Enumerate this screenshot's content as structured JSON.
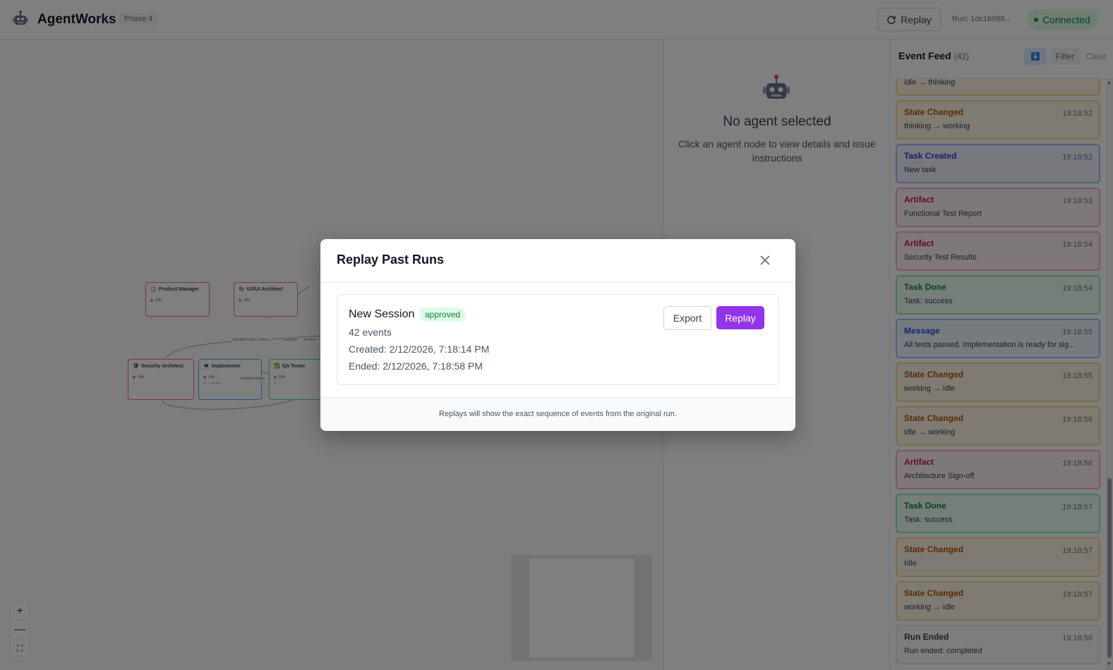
{
  "header": {
    "app_title": "AgentWorks",
    "phase": "Phase 4",
    "replay_label": "Replay",
    "run_id": "Run: 1dc16998...",
    "connection_status": "Connected"
  },
  "canvas": {
    "nodes": [
      {
        "title": "Product Manager",
        "status": "idle",
        "extra": ""
      },
      {
        "title": "UX/UI Architect",
        "status": "idle",
        "extra": ""
      },
      {
        "title": "Security Architect",
        "status": "idle",
        "extra": "2"
      },
      {
        "title": "Implementer",
        "status": "idle",
        "extra": "3 · ⚡ Active"
      },
      {
        "title": "QA Tester",
        "status": "idle",
        "extra": "2"
      }
    ],
    "edge_labels": [
      "Identified risks: creden...",
      "Impleme",
      "All tests",
      "Implementation..."
    ],
    "zoom_in": "+",
    "zoom_out": "—",
    "fit": "⛶"
  },
  "details": {
    "empty_title": "No agent selected",
    "empty_subtitle": "Click an agent node to view details and issue instructions"
  },
  "feed": {
    "title": "Event Feed",
    "count": "(42)",
    "filter_label": "Filter",
    "clear_label": "Clear",
    "events": [
      {
        "type": "",
        "time": "",
        "desc": "idle → thinking",
        "kind": "state"
      },
      {
        "type": "State Changed",
        "time": "19:18:52",
        "desc": "thinking → working",
        "kind": "state"
      },
      {
        "type": "Task Created",
        "time": "19:18:52",
        "desc": "New task",
        "kind": "task"
      },
      {
        "type": "Artifact",
        "time": "19:18:53",
        "desc": "Functional Test Report",
        "kind": "artifact"
      },
      {
        "type": "Artifact",
        "time": "19:18:54",
        "desc": "Security Test Results",
        "kind": "artifact"
      },
      {
        "type": "Task Done",
        "time": "19:18:54",
        "desc": "Task: success",
        "kind": "done"
      },
      {
        "type": "Message",
        "time": "19:18:55",
        "desc": "All tests passed. Implementation is ready for sig...",
        "kind": "message"
      },
      {
        "type": "State Changed",
        "time": "19:18:55",
        "desc": "working → idle",
        "kind": "state"
      },
      {
        "type": "State Changed",
        "time": "19:18:56",
        "desc": "idle → working",
        "kind": "state"
      },
      {
        "type": "Artifact",
        "time": "19:18:56",
        "desc": "Architecture Sign-off",
        "kind": "artifact"
      },
      {
        "type": "Task Done",
        "time": "19:18:57",
        "desc": "Task: success",
        "kind": "done"
      },
      {
        "type": "State Changed",
        "time": "19:18:57",
        "desc": "Idle",
        "kind": "state"
      },
      {
        "type": "State Changed",
        "time": "19:18:57",
        "desc": "working → idle",
        "kind": "state"
      },
      {
        "type": "Run Ended",
        "time": "19:18:58",
        "desc": "Run ended: completed",
        "kind": "ended"
      }
    ]
  },
  "modal": {
    "title": "Replay Past Runs",
    "run": {
      "name": "New Session",
      "status": "approved",
      "events": "42 events",
      "created": "Created: 2/12/2026, 7:18:14 PM",
      "ended": "Ended: 2/12/2026, 7:18:58 PM"
    },
    "export_label": "Export",
    "replay_label": "Replay",
    "footer_note": "Replays will show the exact sequence of events from the original run."
  },
  "colors": {
    "accent_purple": "#9333ea",
    "connected_green": "#15803d",
    "overlay": "rgba(0,0,0,0.5)"
  }
}
